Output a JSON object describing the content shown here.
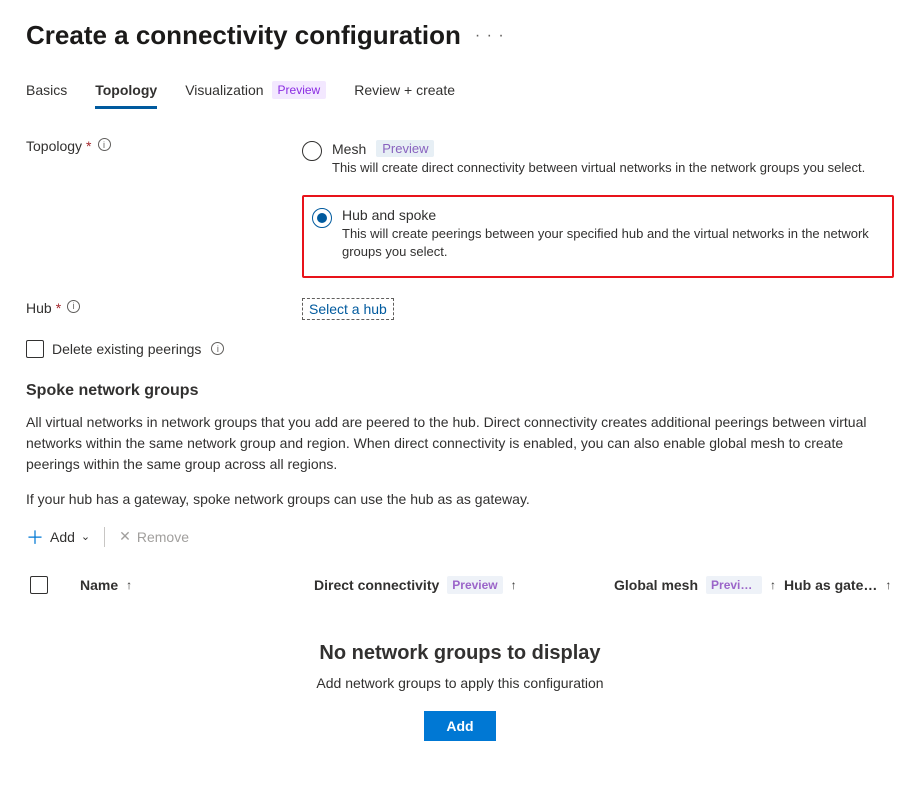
{
  "page": {
    "title": "Create a connectivity configuration"
  },
  "tabs": {
    "basics": "Basics",
    "topology": "Topology",
    "visualization": "Visualization",
    "visualization_badge": "Preview",
    "review": "Review + create"
  },
  "fields": {
    "topology_label": "Topology",
    "hub_label": "Hub",
    "select_hub": "Select a hub",
    "delete_peerings": "Delete existing peerings"
  },
  "options": {
    "mesh": {
      "title": "Mesh",
      "badge": "Preview",
      "desc": "This will create direct connectivity between virtual networks in the network groups you select."
    },
    "hubspoke": {
      "title": "Hub and spoke",
      "desc": "This will create peerings between your specified hub and the virtual networks in the network groups you select."
    }
  },
  "spoke": {
    "heading": "Spoke network groups",
    "para1": "All virtual networks in network groups that you add are peered to the hub. Direct connectivity creates additional peerings between virtual networks within the same network group and region. When direct connectivity is enabled, you can also enable global mesh to create peerings within the same group across all regions.",
    "para2": "If your hub has a gateway, spoke network groups can use the hub as as gateway."
  },
  "toolbar": {
    "add": "Add",
    "remove": "Remove"
  },
  "table": {
    "name": "Name",
    "direct": "Direct connectivity",
    "direct_badge": "Preview",
    "global": "Global mesh",
    "global_badge": "Previe…",
    "hubgw": "Hub as gate…"
  },
  "empty": {
    "title": "No network groups to display",
    "sub": "Add network groups to apply this configuration",
    "button": "Add"
  }
}
